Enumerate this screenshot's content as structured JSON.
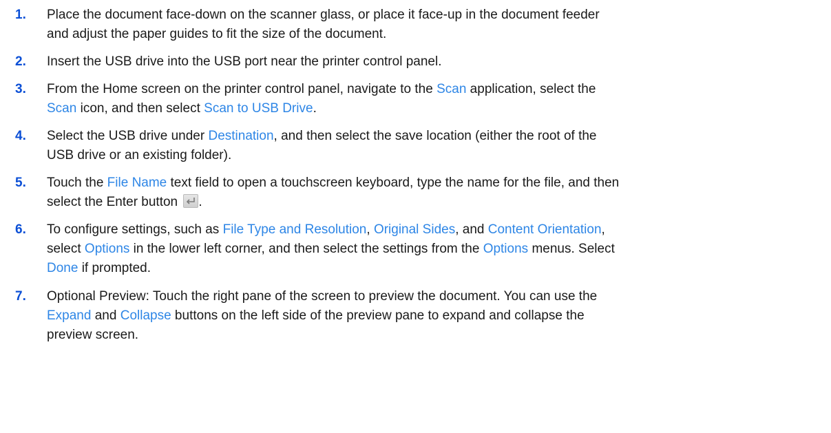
{
  "steps": [
    {
      "num": "1.",
      "lines": [
        [
          {
            "t": "Place the document face-down on the scanner glass, or place it face-up in the document feeder"
          }
        ],
        [
          {
            "t": "and adjust the paper guides to fit the size of the document."
          }
        ]
      ]
    },
    {
      "num": "2.",
      "lines": [
        [
          {
            "t": "Insert the USB drive into the USB port near the printer control panel."
          }
        ]
      ]
    },
    {
      "num": "3.",
      "lines": [
        [
          {
            "t": "From the Home screen on the printer control panel, navigate to the "
          },
          {
            "t": "Scan",
            "link": true
          },
          {
            "t": " application, select the"
          }
        ],
        [
          {
            "t": "Scan",
            "link": true
          },
          {
            "t": " icon, and then select "
          },
          {
            "t": "Scan to USB Drive",
            "link": true
          },
          {
            "t": "."
          }
        ]
      ]
    },
    {
      "num": "4.",
      "lines": [
        [
          {
            "t": "Select the USB drive under "
          },
          {
            "t": "Destination",
            "link": true
          },
          {
            "t": ", and then select the save location (either the root of the"
          }
        ],
        [
          {
            "t": "USB drive or an existing folder)."
          }
        ]
      ]
    },
    {
      "num": "5.",
      "lines": [
        [
          {
            "t": "Touch the "
          },
          {
            "t": "File Name",
            "link": true
          },
          {
            "t": " text field to open a touchscreen keyboard, type the name for the file, and then"
          }
        ],
        [
          {
            "t": "select the Enter button "
          },
          {
            "icon": "enter-key-icon"
          },
          {
            "t": "."
          }
        ]
      ]
    },
    {
      "num": "6.",
      "lines": [
        [
          {
            "t": "To configure settings, such as "
          },
          {
            "t": "File Type and Resolution",
            "link": true
          },
          {
            "t": ", "
          },
          {
            "t": "Original Sides",
            "link": true
          },
          {
            "t": ", and "
          },
          {
            "t": "Content Orientation",
            "link": true
          },
          {
            "t": ","
          }
        ],
        [
          {
            "t": "select "
          },
          {
            "t": "Options",
            "link": true
          },
          {
            "t": " in the lower left corner, and then select the settings from the "
          },
          {
            "t": "Options",
            "link": true
          },
          {
            "t": " menus. Select"
          }
        ],
        [
          {
            "t": "Done",
            "link": true
          },
          {
            "t": " if prompted."
          }
        ]
      ]
    },
    {
      "num": "7.",
      "lines": [
        [
          {
            "t": "Optional Preview: Touch the right pane of the screen to preview the document. You can use the"
          }
        ],
        [
          {
            "t": "Expand",
            "link": true
          },
          {
            "t": " and "
          },
          {
            "t": "Collapse",
            "link": true
          },
          {
            "t": " buttons on the left side of the preview pane to expand and collapse the"
          }
        ],
        [
          {
            "t": "preview screen."
          }
        ]
      ]
    }
  ],
  "colors": {
    "number": "#0b4fd6",
    "link": "#2e86e6",
    "text": "#1a1a1a"
  }
}
